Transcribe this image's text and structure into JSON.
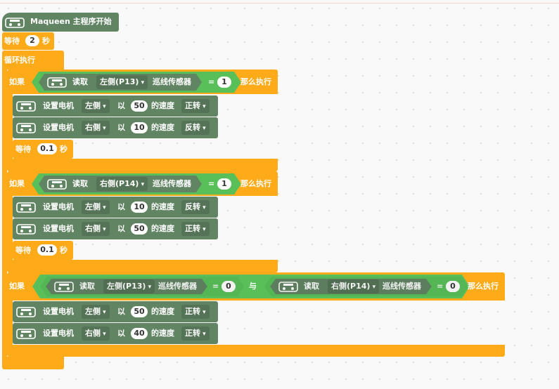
{
  "hat": {
    "label": "Maqueen 主程序开始"
  },
  "wait_top": {
    "label": "等待",
    "value": "2",
    "unit": "秒"
  },
  "loop": {
    "label": "循环执行"
  },
  "if1": {
    "if_label": "如果",
    "read_label": "读取",
    "sensor_side": "左侧(P13)",
    "sensor_label": "巡线传感器",
    "eq": "=",
    "value": "1",
    "then_label": "那么执行",
    "motors": [
      {
        "label": "设置电机",
        "side": "左侧",
        "with": "以",
        "speed": "50",
        "speed_label": "的速度",
        "dir": "正转"
      },
      {
        "label": "设置电机",
        "side": "右侧",
        "with": "以",
        "speed": "10",
        "speed_label": "的速度",
        "dir": "反转"
      }
    ],
    "wait": {
      "label": "等待",
      "value": "0.1",
      "unit": "秒"
    }
  },
  "if2": {
    "if_label": "如果",
    "read_label": "读取",
    "sensor_side": "右侧(P14)",
    "sensor_label": "巡线传感器",
    "eq": "=",
    "value": "1",
    "then_label": "那么执行",
    "motors": [
      {
        "label": "设置电机",
        "side": "左侧",
        "with": "以",
        "speed": "10",
        "speed_label": "的速度",
        "dir": "反转"
      },
      {
        "label": "设置电机",
        "side": "右侧",
        "with": "以",
        "speed": "50",
        "speed_label": "的速度",
        "dir": "正转"
      }
    ],
    "wait": {
      "label": "等待",
      "value": "0.1",
      "unit": "秒"
    }
  },
  "if3": {
    "if_label": "如果",
    "left": {
      "read_label": "读取",
      "sensor_side": "左侧(P13)",
      "sensor_label": "巡线传感器",
      "eq": "=",
      "value": "0"
    },
    "and_label": "与",
    "right": {
      "read_label": "读取",
      "sensor_side": "右侧(P14)",
      "sensor_label": "巡线传感器",
      "eq": "=",
      "value": "0"
    },
    "then_label": "那么执行",
    "motors": [
      {
        "label": "设置电机",
        "side": "左侧",
        "with": "以",
        "speed": "50",
        "speed_label": "的速度",
        "dir": "正转"
      },
      {
        "label": "设置电机",
        "side": "右侧",
        "with": "以",
        "speed": "40",
        "speed_label": "的速度",
        "dir": "正转"
      }
    ]
  },
  "colors": {
    "event": "#618463",
    "control": "#ffab19",
    "operator": "#59c059",
    "canvas": "#f9f9f9"
  },
  "icons": {
    "robot": "maqueen-robot-icon"
  }
}
